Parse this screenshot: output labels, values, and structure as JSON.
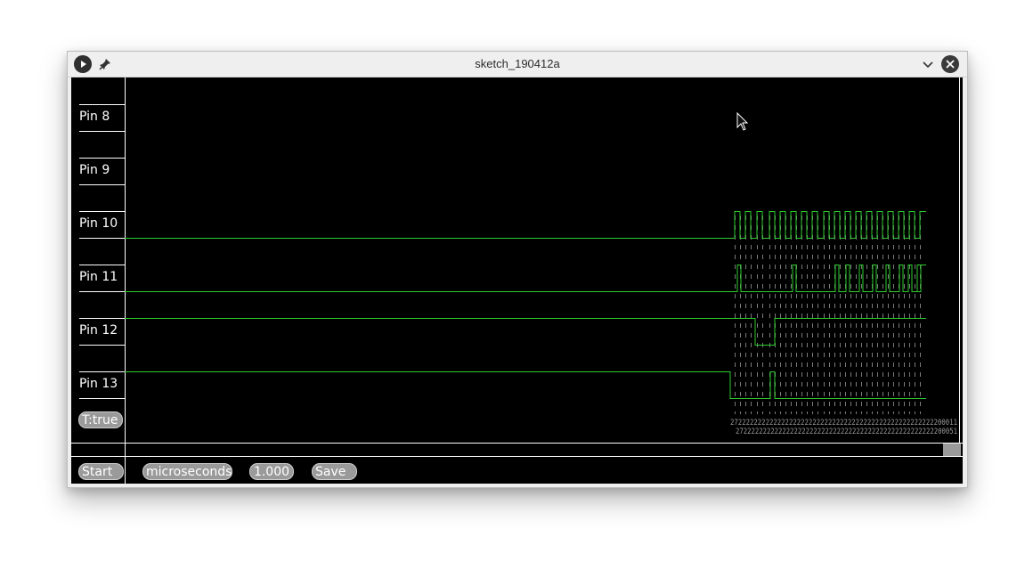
{
  "window": {
    "title": "sketch_190412a"
  },
  "pins": [
    {
      "label": "Pin 8"
    },
    {
      "label": "Pin 9"
    },
    {
      "label": "Pin 10"
    },
    {
      "label": "Pin 11"
    },
    {
      "label": "Pin 12"
    },
    {
      "label": "Pin 13"
    }
  ],
  "trigger_toggle": {
    "label": "T:true"
  },
  "toolbar": {
    "start_label": "Start",
    "units_label": "microseconds",
    "scale_label": "1.000",
    "save_label": "Save"
  },
  "timestamps": {
    "row1": "2722222222222222222222222222222222222222222222222222200011",
    "row2": "272222222222222222222222222222222222222222222222222200051"
  },
  "colors": {
    "background": "#000000",
    "signal": "#2ecc2e",
    "grid": "#ffffff",
    "marker": "#9a9a9a",
    "button": "#9a9a9a"
  },
  "icons": [
    "menu-play-icon",
    "pin-icon",
    "chevron-down-icon",
    "close-icon",
    "mouse-cursor-icon"
  ]
}
